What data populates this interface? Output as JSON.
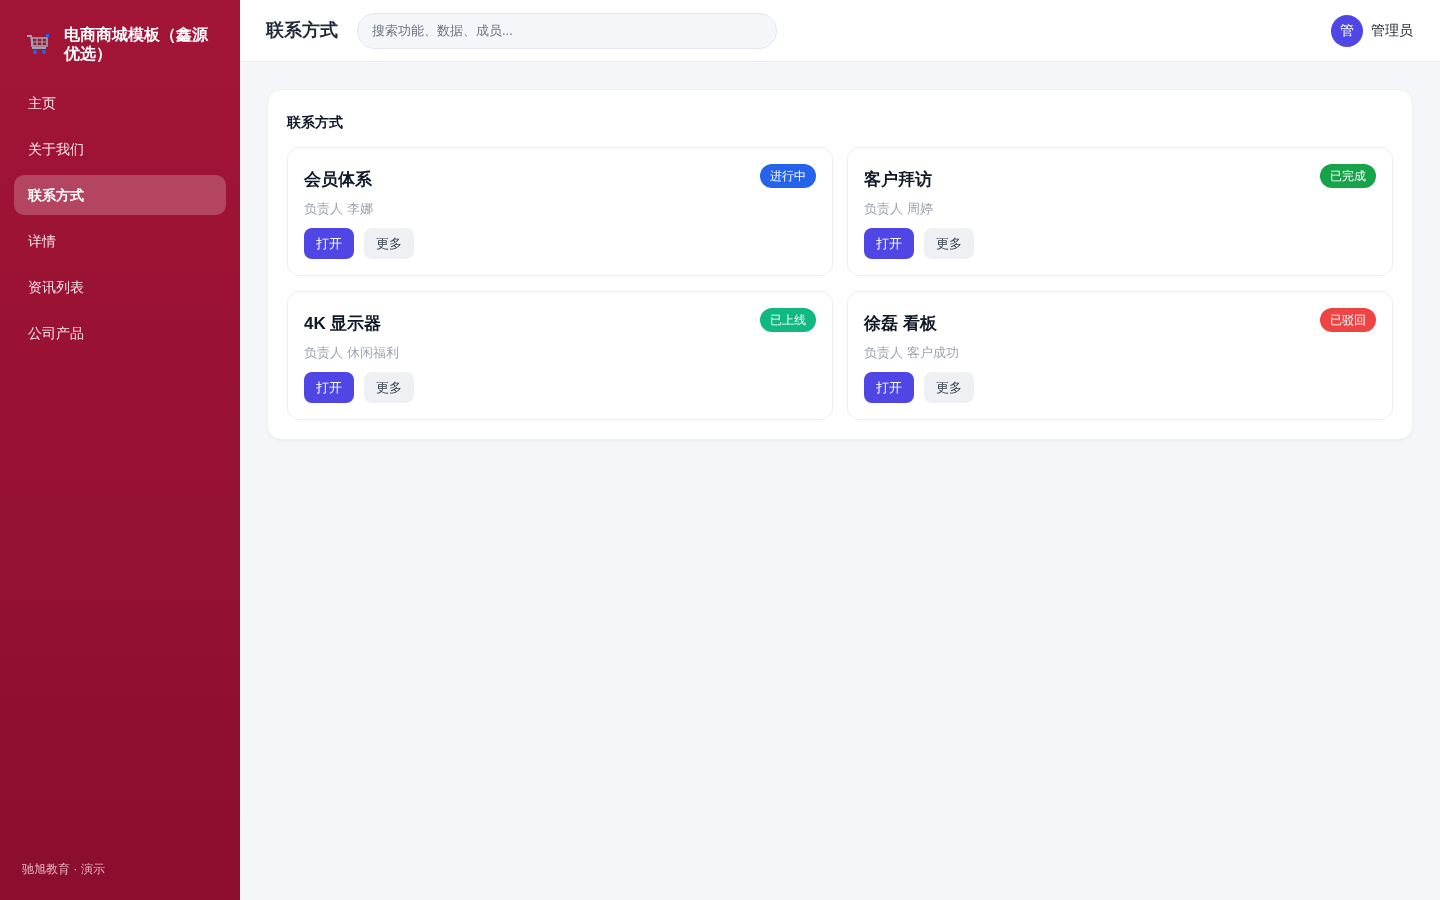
{
  "sidebar": {
    "brand": "电商商城模板（鑫源优选）",
    "items": [
      {
        "label": "主页",
        "selected": false
      },
      {
        "label": "关于我们",
        "selected": false
      },
      {
        "label": "联系方式",
        "selected": true
      },
      {
        "label": "详情",
        "selected": false
      },
      {
        "label": "资讯列表",
        "selected": false
      },
      {
        "label": "公司产品",
        "selected": false
      }
    ],
    "footer": "驰旭教育 · 演示"
  },
  "header": {
    "title": "联系方式",
    "search": {
      "placeholder": "搜索功能、数据、成员..."
    },
    "user": {
      "avatar": "管",
      "name": "管理员"
    }
  },
  "panel": {
    "title": "联系方式",
    "cards": [
      {
        "title": "会员体系",
        "owner": "负责人 李娜",
        "status": {
          "label": "进行中",
          "color": "#2563eb"
        },
        "buttons": [
          "打开",
          "更多"
        ]
      },
      {
        "title": "客户拜访",
        "owner": "负责人 周婷",
        "status": {
          "label": "已完成",
          "color": "#16a34a"
        },
        "buttons": [
          "打开",
          "更多"
        ]
      },
      {
        "title": "4K 显示器",
        "owner": "负责人 休闲福利",
        "status": {
          "label": "已上线",
          "color": "#10b981"
        },
        "buttons": [
          "打开",
          "更多"
        ]
      },
      {
        "title": "徐磊 看板",
        "owner": "负责人 客户成功",
        "status": {
          "label": "已驳回",
          "color": "#ef4444"
        },
        "buttons": [
          "打开",
          "更多"
        ]
      }
    ]
  }
}
